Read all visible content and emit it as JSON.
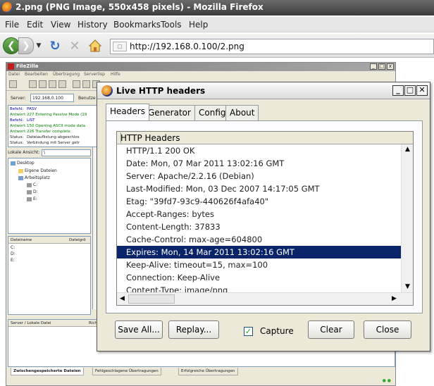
{
  "firefox": {
    "title": "2.png (PNG Image, 550x458 pixels) - Mozilla Firefox",
    "menu": [
      "File",
      "Edit",
      "View",
      "History",
      "Bookmarks",
      "Tools",
      "Help"
    ],
    "url": "http://192.168.0.100/2.png"
  },
  "filezilla": {
    "title": "FileZilla",
    "menu": [
      "Datei",
      "Bearbeiten",
      "Übertragung",
      "Serverlisp",
      "Hilfe"
    ],
    "server_label": "Server:",
    "server_value": "192.168.0.100",
    "user_label": "Benutze",
    "log": [
      {
        "k": "Befehl:",
        "v": "PASV"
      },
      {
        "k": "Antwort:",
        "v": "227 Entering Passive Mode (19"
      },
      {
        "k": "Befehl:",
        "v": "LIST"
      },
      {
        "k": "Antwort:",
        "v": "150 Opening ASCII mode data"
      },
      {
        "k": "Antwort:",
        "v": "226 Transfer complete."
      },
      {
        "k": "Status:",
        "v": "Dateiauflistung abgeschlos"
      },
      {
        "k": "Status:",
        "v": "Verbindung mit Server getr"
      }
    ],
    "local_label": "Lokale Ansicht:",
    "local_path": "\\",
    "tree": [
      "Desktop",
      "Eigene Dateien",
      "Arbeitsplatz",
      "C:",
      "D:",
      "E:"
    ],
    "file_headers": [
      "Dateiname",
      "Dateigrö"
    ],
    "files": [
      "C:",
      "D:",
      "E:"
    ],
    "queue_headers": [
      "Server / Lokale Datei",
      "Rich"
    ],
    "tabs": [
      "Zwischengespeicherte Dateien",
      "Fehlgeschlagene Übertragungen",
      "Erfolgreiche Übertragungen"
    ]
  },
  "dialog": {
    "title": "Live HTTP headers",
    "tabs": [
      "Headers",
      "Generator",
      "Config",
      "About"
    ],
    "list_header": "HTTP Headers",
    "rows": [
      "HTTP/1.1 200 OK",
      "Date: Mon, 07 Mar 2011 13:02:16 GMT",
      "Server: Apache/2.2.16 (Debian)",
      "Last-Modified: Mon, 03 Dec 2007 14:17:05 GMT",
      "Etag: \"39fd7-93c9-440626f4afa40\"",
      "Accept-Ranges: bytes",
      "Content-Length: 37833",
      "Cache-Control: max-age=604800",
      "Expires: Mon, 14 Mar 2011 13:02:16 GMT",
      "Keep-Alive: timeout=15, max=100",
      "Connection: Keep-Alive",
      "Content-Type: image/png"
    ],
    "selected_row": 8,
    "buttons": {
      "save_all": "Save All...",
      "replay": "Replay...",
      "capture": "Capture",
      "clear": "Clear",
      "close": "Close"
    },
    "capture_checked": true
  },
  "colors": {
    "selection": "#0a246a",
    "dialog_bg": "#ece9d8"
  }
}
